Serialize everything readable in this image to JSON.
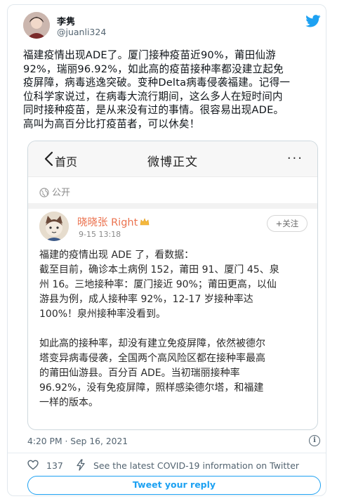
{
  "author": {
    "name": "李隽",
    "handle": "@juanli324"
  },
  "tweet_text": "福建疫情出现ADE了。厦门接种疫苗近90%，莆田仙游\n92%，瑞丽96.92%，如此高的疫苗接种率都没建立起免\n疫屏障，病毒逃逸突破。变种Delta病毒侵袭福建。记得一\n位科学家说过，在病毒大流行期间，这么多人在短时间内\n同时接种疫苗，是从来没有过的事情。很容易出现ADE。\n高叫为高百分比打疫苗者，可以休矣！",
  "embedded": {
    "back_label": "首页",
    "page_title": "微博正文",
    "more": "···",
    "visibility": "公开",
    "user_name": "晓晓张 Right",
    "post_time": "9-15 13:18",
    "follow_label": "+关注",
    "body": "福建的疫情出现 ADE 了，看数据：\n截至目前，确诊本土病例 152，莆田 91、厦门 45、泉\n州 16。三地接种率：厦门接近 90%；莆田更高，以仙\n游县为例，成人接种率 92%，12-17 岁接种率达\n100%！泉州接种率没看到。\n\n如此高的接种率，却没有建立免疫屏障，依然被德尔\n塔变异病毒侵袭，全国两个高风险区都在接种率最高\n的莆田仙游县。百分百 ADE。当初瑞丽接种率\n96.92%，没有免疫屏障，照样感染德尔塔，和福建\n一样的版本。"
  },
  "meta": {
    "timestamp": "4:20 PM · Sep 16, 2021",
    "info_icon": "i"
  },
  "actions": {
    "like_count": "137",
    "covid_info": "See the latest COVID-19 information on Twitter",
    "reply_label": "Tweet your reply"
  },
  "colors": {
    "twitter_blue": "#1da1f2",
    "weibo_orange": "#eb7350"
  },
  "icons": {
    "twitter": "twitter-bird-icon",
    "back": "chevron-left-icon",
    "globe": "globe-icon",
    "crown": "crown-icon",
    "info": "info-icon",
    "like": "heart-icon",
    "covid": "lightning-icon"
  }
}
